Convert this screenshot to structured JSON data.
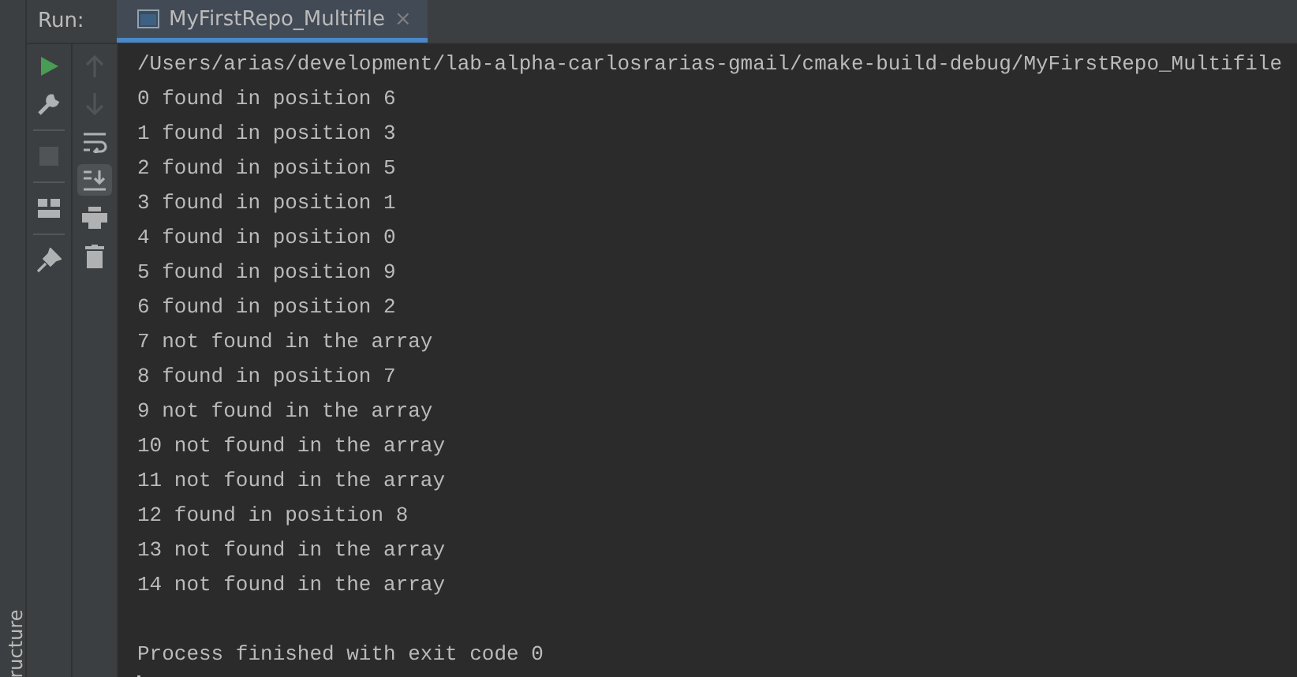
{
  "side_strip": {
    "label": "ructure"
  },
  "header": {
    "label": "Run:",
    "tab": {
      "title": "MyFirstRepo_Multifile",
      "close": "×",
      "selected": true
    }
  },
  "toolbar_left": [
    {
      "kind": "run",
      "disabled": false
    },
    {
      "kind": "wrench",
      "disabled": false
    },
    {
      "kind": "stop",
      "disabled": true
    },
    {
      "kind": "layout",
      "disabled": false
    },
    {
      "kind": "pin",
      "disabled": false
    }
  ],
  "toolbar_right": [
    {
      "kind": "up",
      "disabled": true,
      "on": false
    },
    {
      "kind": "down",
      "disabled": true,
      "on": false
    },
    {
      "kind": "wrap",
      "disabled": false,
      "on": false
    },
    {
      "kind": "scroll",
      "disabled": false,
      "on": true
    },
    {
      "kind": "print",
      "disabled": false,
      "on": false
    },
    {
      "kind": "trash",
      "disabled": false,
      "on": false
    }
  ],
  "console": {
    "lines": [
      {
        "kind": "command",
        "text": "/Users/arias/development/lab-alpha-carlosrarias-gmail/cmake-build-debug/MyFirstRepo_Multifile"
      },
      {
        "kind": "output",
        "text": "0 found in position 6"
      },
      {
        "kind": "output",
        "text": "1 found in position 3"
      },
      {
        "kind": "output",
        "text": "2 found in position 5"
      },
      {
        "kind": "output",
        "text": "3 found in position 1"
      },
      {
        "kind": "output",
        "text": "4 found in position 0"
      },
      {
        "kind": "output",
        "text": "5 found in position 9"
      },
      {
        "kind": "output",
        "text": "6 found in position 2"
      },
      {
        "kind": "output",
        "text": "7 not found in the array"
      },
      {
        "kind": "output",
        "text": "8 found in position 7"
      },
      {
        "kind": "output",
        "text": "9 not found in the array"
      },
      {
        "kind": "output",
        "text": "10 not found in the array"
      },
      {
        "kind": "output",
        "text": "11 not found in the array"
      },
      {
        "kind": "output",
        "text": "12 found in position 8"
      },
      {
        "kind": "output",
        "text": "13 not found in the array"
      },
      {
        "kind": "output",
        "text": "14 not found in the array"
      },
      {
        "kind": "exit",
        "text": "Process finished with exit code 0"
      }
    ]
  }
}
